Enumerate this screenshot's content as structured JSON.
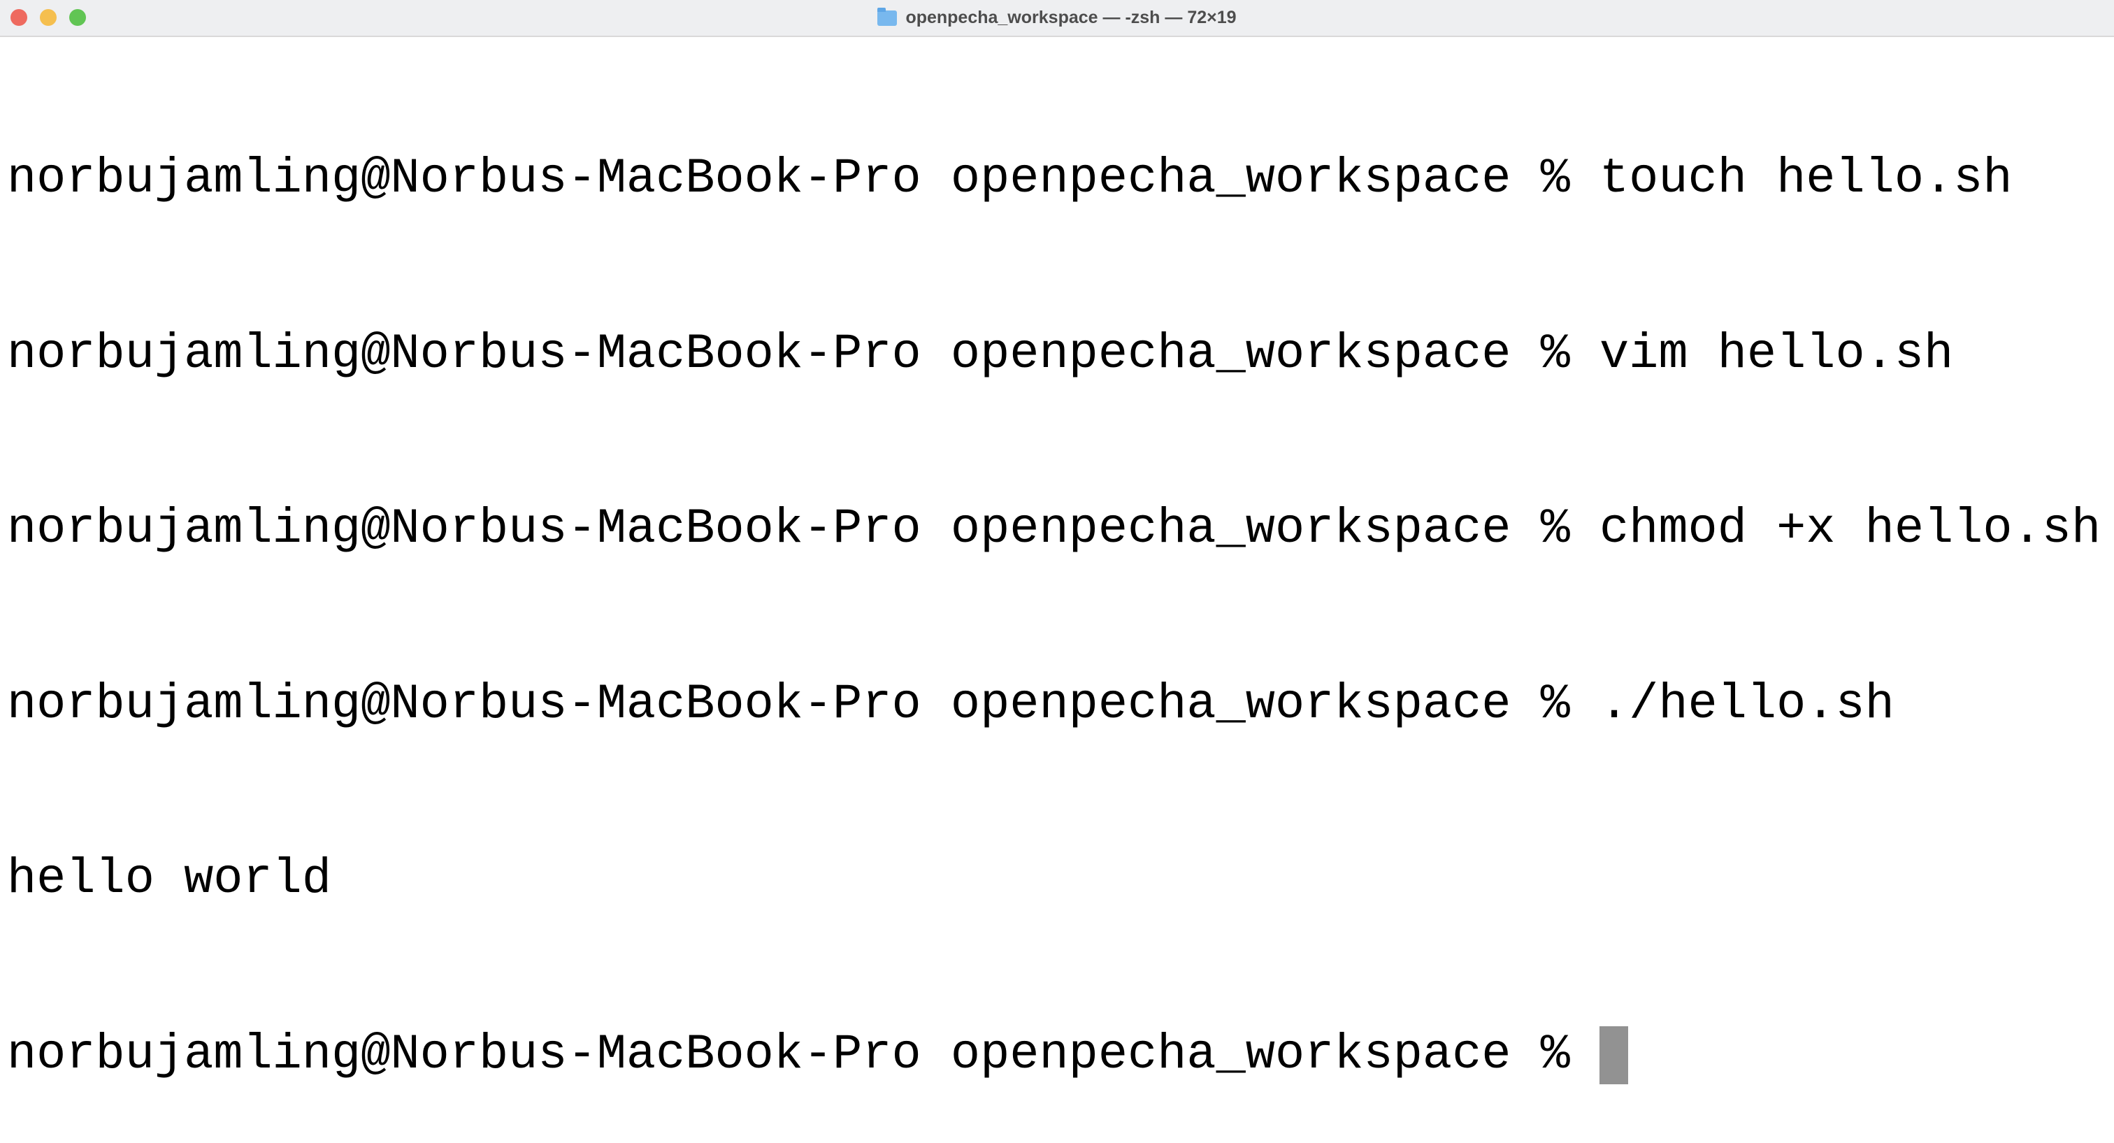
{
  "window": {
    "title": "openpecha_workspace — -zsh — 72×19"
  },
  "terminal": {
    "lines": [
      "norbujamling@Norbus-MacBook-Pro openpecha_workspace % touch hello.sh",
      "norbujamling@Norbus-MacBook-Pro openpecha_workspace % vim hello.sh",
      "norbujamling@Norbus-MacBook-Pro openpecha_workspace % chmod +x hello.sh",
      "norbujamling@Norbus-MacBook-Pro openpecha_workspace % ./hello.sh",
      "hello world"
    ],
    "prompt": "norbujamling@Norbus-MacBook-Pro openpecha_workspace % "
  }
}
